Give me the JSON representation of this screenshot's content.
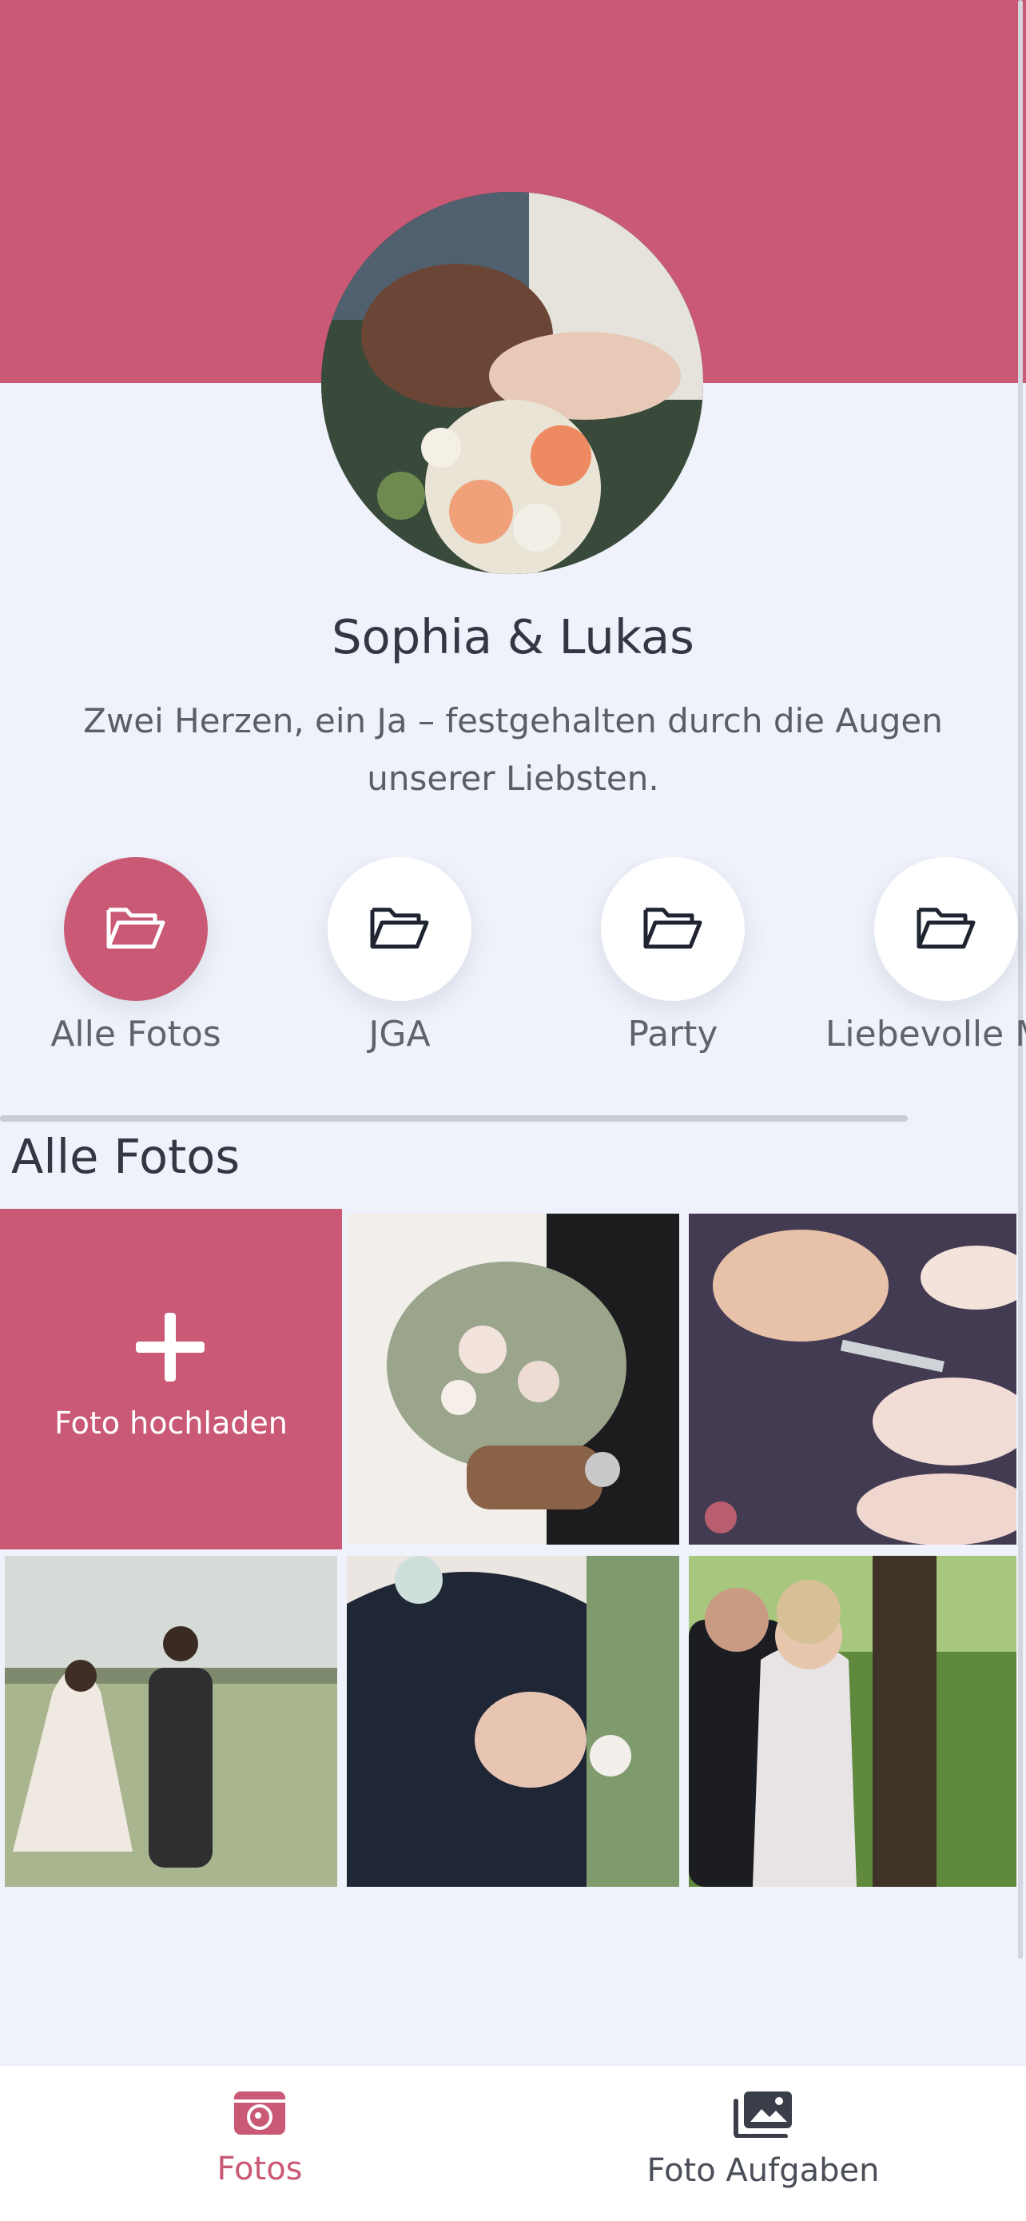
{
  "profile": {
    "title": "Sophia & Lukas",
    "subtitle": "Zwei Herzen, ein Ja – festgehalten durch die Augen unserer Liebsten."
  },
  "albums": [
    {
      "label": "Alle Fotos",
      "icon": "folder-open-icon",
      "active": true
    },
    {
      "label": "JGA",
      "icon": "folder-open-icon",
      "active": false
    },
    {
      "label": "Party",
      "icon": "folder-open-icon",
      "active": false
    },
    {
      "label": "Liebevolle Mo",
      "icon": "folder-open-icon",
      "active": false
    }
  ],
  "section": {
    "title": "Alle Fotos"
  },
  "upload": {
    "label": "Foto hochladen",
    "icon": "plus-icon"
  },
  "photos": [
    {
      "name": "bouquet-hands-photo"
    },
    {
      "name": "cake-cutting-photo"
    },
    {
      "name": "couple-field-photo"
    },
    {
      "name": "embrace-photo"
    },
    {
      "name": "couple-tree-photo"
    }
  ],
  "nav": {
    "fotos_label": "Fotos",
    "tasks_label": "Foto Aufgaben"
  },
  "colors": {
    "accent": "#c95975",
    "background": "#eff2fa",
    "text": "#333743"
  }
}
